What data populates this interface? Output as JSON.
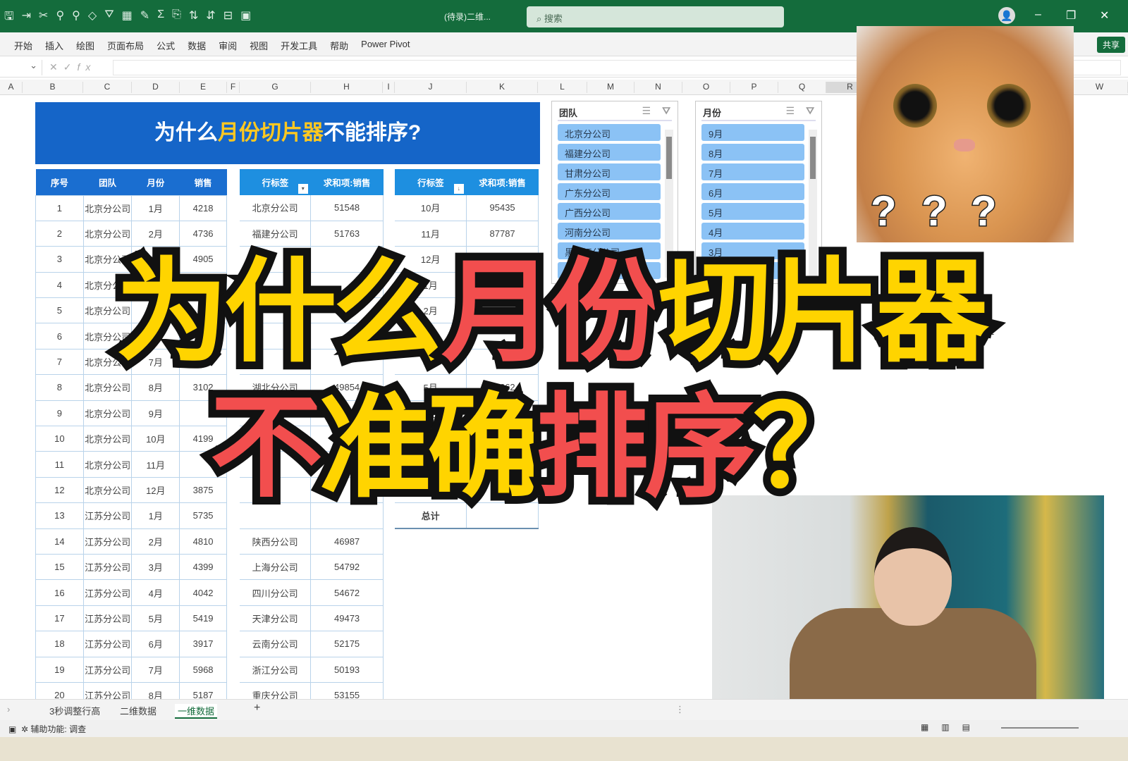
{
  "titlebar": {
    "doc_name": "(待录)二维...",
    "search_placeholder": "搜索",
    "minimize": "–",
    "restore": "❐",
    "close": "✕",
    "avatar": "👤"
  },
  "quick_access_icons": [
    "save-icon",
    "insert-icon",
    "cut-icon",
    "paint-icon",
    "paint2-icon",
    "shapes-icon",
    "filter-icon",
    "table-icon",
    "brush-icon",
    "sum-icon",
    "copy-icon",
    "sort-asc-icon",
    "sort-desc-icon",
    "freeze-icon",
    "layout-icon"
  ],
  "menu": [
    "开始",
    "插入",
    "绘图",
    "页面布局",
    "公式",
    "数据",
    "审阅",
    "视图",
    "开发工具",
    "帮助",
    "Power Pivot"
  ],
  "share_label": "共享",
  "formula": {
    "fx": "fx",
    "value": ""
  },
  "columns": [
    "A",
    "B",
    "C",
    "D",
    "E",
    "F",
    "G",
    "H",
    "I",
    "J",
    "K",
    "L",
    "M",
    "N",
    "O",
    "P",
    "Q",
    "R",
    "W"
  ],
  "banner": {
    "pre": "为什么",
    "highlight": "月份切片器",
    "post": "不能排序?"
  },
  "table1": {
    "headers": [
      "序号",
      "团队",
      "月份",
      "销售"
    ],
    "rows": [
      [
        "1",
        "北京分公司",
        "1月",
        "4218"
      ],
      [
        "2",
        "北京分公司",
        "2月",
        "4736"
      ],
      [
        "3",
        "北京分公司",
        "3月",
        "4905"
      ],
      [
        "4",
        "北京分公司",
        "4月",
        ""
      ],
      [
        "5",
        "北京分公司",
        "5月",
        ""
      ],
      [
        "6",
        "北京分公司",
        "6月",
        ""
      ],
      [
        "7",
        "北京分公司",
        "7月",
        ""
      ],
      [
        "8",
        "北京分公司",
        "8月",
        "3102"
      ],
      [
        "9",
        "北京分公司",
        "9月",
        ""
      ],
      [
        "10",
        "北京分公司",
        "10月",
        "4199"
      ],
      [
        "11",
        "北京分公司",
        "11月",
        ""
      ],
      [
        "12",
        "北京分公司",
        "12月",
        "3875"
      ],
      [
        "13",
        "江苏分公司",
        "1月",
        "5735"
      ],
      [
        "14",
        "江苏分公司",
        "2月",
        "4810"
      ],
      [
        "15",
        "江苏分公司",
        "3月",
        "4399"
      ],
      [
        "16",
        "江苏分公司",
        "4月",
        "4042"
      ],
      [
        "17",
        "江苏分公司",
        "5月",
        "5419"
      ],
      [
        "18",
        "江苏分公司",
        "6月",
        "3917"
      ],
      [
        "19",
        "江苏分公司",
        "7月",
        "5968"
      ],
      [
        "20",
        "江苏分公司",
        "8月",
        "5187"
      ]
    ]
  },
  "table2": {
    "headers": [
      "行标签",
      "求和项:销售"
    ],
    "rows": [
      [
        "北京分公司",
        "51548"
      ],
      [
        "福建分公司",
        "51763"
      ],
      [
        "",
        ""
      ],
      [
        "",
        ""
      ],
      [
        "",
        ""
      ],
      [
        "",
        ""
      ],
      [
        "",
        ""
      ],
      [
        "湖北分公司",
        "49854"
      ],
      [
        "",
        ""
      ],
      [
        "",
        ""
      ],
      [
        "",
        ""
      ],
      [
        "",
        ""
      ],
      [
        "",
        ""
      ],
      [
        "陕西分公司",
        "46987"
      ],
      [
        "上海分公司",
        "54792"
      ],
      [
        "四川分公司",
        "54672"
      ],
      [
        "天津分公司",
        "49473"
      ],
      [
        "云南分公司",
        "52175"
      ],
      [
        "浙江分公司",
        "50193"
      ],
      [
        "重庆分公司",
        "53155"
      ]
    ]
  },
  "table3": {
    "headers": [
      "行标签",
      "求和项:销售"
    ],
    "rows": [
      [
        "10月",
        "95435"
      ],
      [
        "11月",
        "87787"
      ],
      [
        "12月",
        ""
      ],
      [
        "1月",
        ""
      ],
      [
        "2月",
        ""
      ],
      [
        "3月",
        ""
      ],
      [
        "4月",
        ""
      ],
      [
        "5月",
        "89262"
      ],
      [
        "6月",
        ""
      ],
      [
        "7月",
        ""
      ],
      [
        "8月",
        ""
      ],
      [
        "9月",
        ""
      ],
      [
        "总计",
        ""
      ]
    ]
  },
  "slicer_team": {
    "title": "团队",
    "items": [
      "北京分公司",
      "福建分公司",
      "甘肃分公司",
      "广东分公司",
      "广西分公司",
      "河南分公司",
      "黑龙江分公司",
      ""
    ]
  },
  "slicer_month": {
    "title": "月份",
    "items": [
      "9月",
      "8月",
      "7月",
      "6月",
      "5月",
      "4月",
      "3月",
      ""
    ]
  },
  "cat_marks": [
    "?",
    "?",
    "?"
  ],
  "overlay": {
    "line1": [
      {
        "text": "为什么",
        "color": "yellow"
      },
      {
        "text": "月份",
        "color": "red"
      },
      {
        "text": "切片器",
        "color": "yellow"
      }
    ],
    "line2": [
      {
        "text": "不",
        "color": "red"
      },
      {
        "text": "准确",
        "color": "yellow"
      },
      {
        "text": "排序",
        "color": "red"
      },
      {
        "text": "？",
        "color": "yellow"
      }
    ]
  },
  "colors": {
    "excel_green": "#146c3c",
    "banner_blue": "#1565c8",
    "header_blue": "#1a6ed0",
    "slicer_item": "#8bc2f5",
    "yellow": "#ffd400",
    "red": "#f24e4e"
  },
  "sheet_tabs": [
    {
      "label": "3秒调整行高",
      "active": false
    },
    {
      "label": "二维数据",
      "active": false
    },
    {
      "label": "一维数据",
      "active": true
    }
  ],
  "add_sheet": "+",
  "status": {
    "accessibility": "辅助功能: 调查"
  }
}
